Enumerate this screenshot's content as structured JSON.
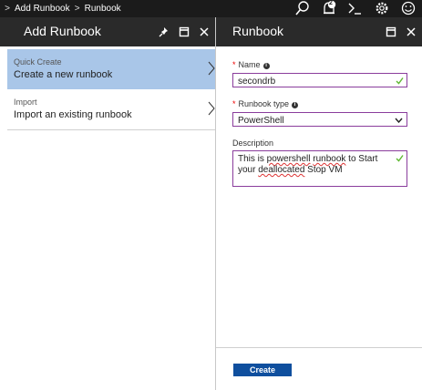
{
  "breadcrumb": {
    "items": [
      "Add Runbook",
      "Runbook"
    ]
  },
  "topbar": {
    "notification_count": "2"
  },
  "left_blade": {
    "title": "Add Runbook",
    "options": [
      {
        "label": "Quick Create",
        "description": "Create a new runbook",
        "selected": true
      },
      {
        "label": "Import",
        "description": "Import an existing runbook",
        "selected": false
      }
    ]
  },
  "right_blade": {
    "title": "Runbook",
    "name_label": "Name",
    "name_value": "secondrb",
    "type_label": "Runbook type",
    "type_value": "PowerShell",
    "description_label": "Description",
    "description_parts": [
      "This is ",
      "powershell",
      " ",
      "runbook",
      " to Start your ",
      "deallocated",
      " Stop VM"
    ],
    "create_label": "Create"
  },
  "colors": {
    "selected_bg": "#a9c6e8",
    "accent_border": "#8a3d9c",
    "button": "#0f4f9e",
    "check": "#5fb832"
  }
}
